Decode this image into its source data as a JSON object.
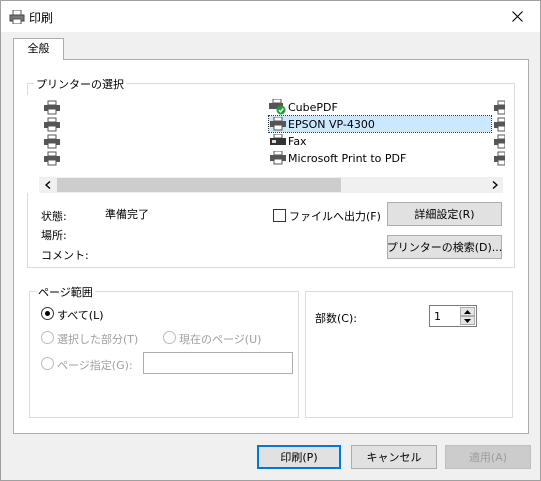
{
  "window": {
    "title": "印刷"
  },
  "tabs": [
    {
      "label": "全般"
    }
  ],
  "printer_group": {
    "label": "プリンターの選択",
    "printers": [
      {
        "name": "CubePDF",
        "icon": "printer-default-icon"
      },
      {
        "name": "EPSON VP-4300",
        "icon": "printer-icon"
      },
      {
        "name": "Fax",
        "icon": "fax-icon"
      },
      {
        "name": "Microsoft Print to PDF",
        "icon": "printer-icon"
      }
    ],
    "selected": "EPSON VP-4300"
  },
  "status": {
    "status_label": "状態:",
    "status_value": "準備完了",
    "location_label": "場所:",
    "location_value": "",
    "comment_label": "コメント:",
    "comment_value": ""
  },
  "print_to_file": {
    "label": "ファイルへ出力(F)",
    "checked": false
  },
  "buttons": {
    "preferences": "詳細設定(R)",
    "find_printer": "プリンターの検索(D)...",
    "print": "印刷(P)",
    "cancel": "キャンセル",
    "apply": "適用(A)"
  },
  "page_range": {
    "label": "ページ範囲",
    "all": "すべて(L)",
    "selection": "選択した部分(T)",
    "current_page": "現在のページ(U)",
    "pages": "ページ指定(G):",
    "pages_value": ""
  },
  "copies": {
    "label": "部数(C):",
    "value": "1"
  },
  "colors": {
    "accent": "#0078d7",
    "selection": "#cce8ff",
    "check_green": "#1e9e3a"
  }
}
